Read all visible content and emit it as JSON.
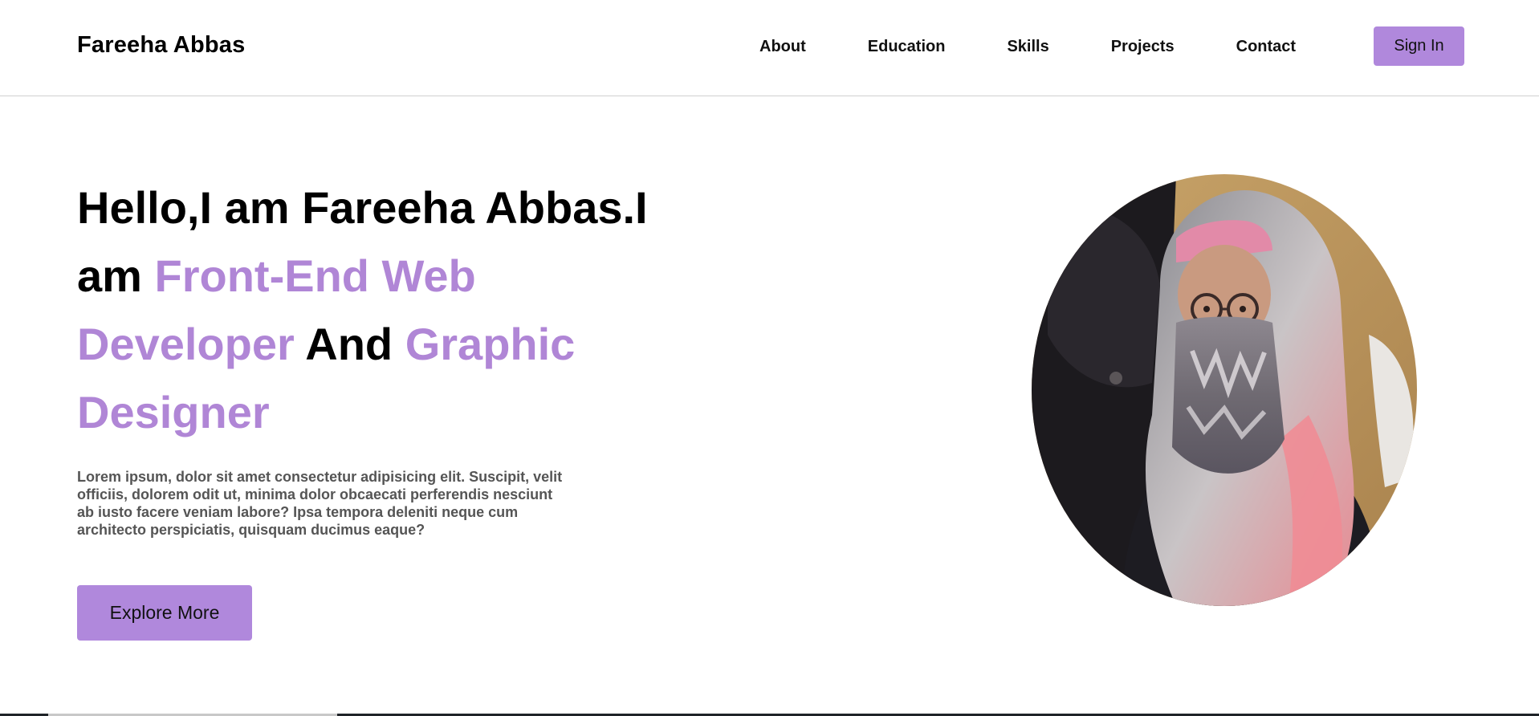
{
  "nav": {
    "brand": "Fareeha Abbas",
    "links": [
      {
        "label": "About"
      },
      {
        "label": "Education"
      },
      {
        "label": "Skills"
      },
      {
        "label": "Projects"
      },
      {
        "label": "Contact"
      }
    ],
    "signin_label": "Sign In"
  },
  "hero": {
    "title_part1": "Hello,I am Fareeha Abbas.I am ",
    "title_accent1": "Front-End Web Developer",
    "title_part2": " And ",
    "title_accent2": "Graphic Designer",
    "description": "Lorem ipsum, dolor sit amet consectetur adipisicing elit. Suscipit, velit officiis, dolorem odit ut, minima dolor obcaecati perferendis nesciunt ab iusto facere veniam labore? Ipsa tempora deleniti neque cum architecto perspiciatis, quisquam ducimus eaque?",
    "cta_label": "Explore More"
  },
  "colors": {
    "accent": "#b086d6",
    "button_bg": "#b088dc",
    "text_primary": "#000000",
    "text_muted": "#555555"
  },
  "icons": {
    "portrait": "profile-photo"
  }
}
